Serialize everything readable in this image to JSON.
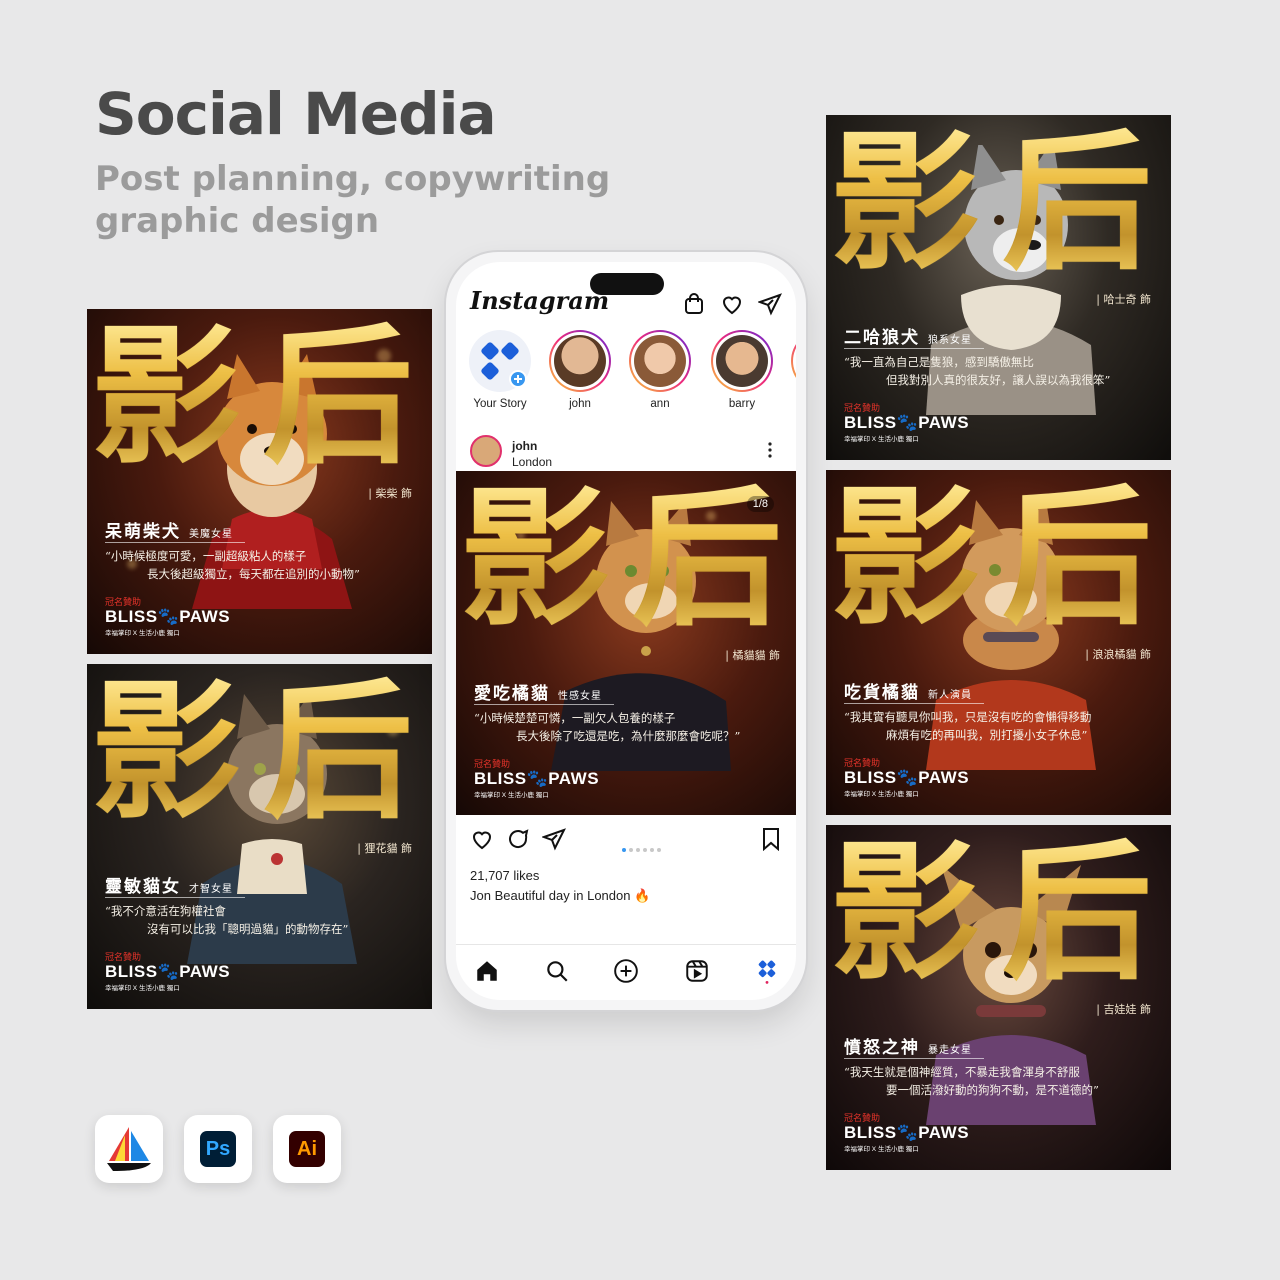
{
  "header": {
    "title": "Social Media",
    "subtitle": "Post planning, copywriting graphic design"
  },
  "poster_common": {
    "big_left": "影",
    "big_right": "后",
    "sponsor": "冠名贊助",
    "brand": "BLISS🐾PAWS",
    "brand_sub": "幸福掌印 X 生活小鹿 獨口"
  },
  "posters": [
    {
      "cast": "| 柴柴 飾",
      "role": "呆萌柴犬",
      "tag": "美魔女星",
      "quote": [
        "“小時候極度可愛，一副超級粘人的樣子",
        "長大後超級獨立，每天都在追別的小動物”"
      ],
      "animal": "shiba"
    },
    {
      "cast": "| 狸花貓 飾",
      "role": "靈敏貓女",
      "tag": "才智女星",
      "quote": [
        "“我不介意活在狗權社會",
        "沒有可以比我「聰明過貓」的動物存在”"
      ],
      "animal": "tabby"
    },
    {
      "cast": "| 哈士奇 飾",
      "role": "二哈狼犬",
      "tag": "狼系女星",
      "quote": [
        "“我一直為自己是隻狼，感到驕傲無比",
        "但我對別人真的很友好，讓人誤以為我很笨”"
      ],
      "animal": "husky"
    },
    {
      "cast": "| 浪浪橘貓 飾",
      "role": "吃貨橘貓",
      "tag": "新人演員",
      "quote": [
        "“我其實有聽見你叫我，只是沒有吃的會懶得移動",
        "麻煩有吃的再叫我，別打擾小女子休息”"
      ],
      "animal": "orange"
    },
    {
      "cast": "| 吉娃娃 飾",
      "role": "憤怒之神",
      "tag": "暴走女星",
      "quote": [
        "“我天生就是個神經質，不暴走我會渾身不舒服",
        "要一個活潑好動的狗狗不動，是不道德的”"
      ],
      "animal": "chihuahua"
    }
  ],
  "instagram": {
    "logo": "Instagram",
    "stories": [
      {
        "name": "Your Story"
      },
      {
        "name": "john"
      },
      {
        "name": "ann"
      },
      {
        "name": "barry"
      }
    ],
    "post": {
      "user": "john",
      "location": "London",
      "counter": "1/8",
      "cast": "| 橘貓貓 飾",
      "role": "愛吃橘貓",
      "tag": "性感女星",
      "quote": [
        "“小時候楚楚可憐，一副欠人包養的樣子",
        "長大後除了吃還是吃，為什麼那麼會吃呢？”"
      ],
      "likes": "21,707 likes",
      "caption_user": "Jon",
      "caption_text": "Beautiful day in London 🔥",
      "carousel_count": 6,
      "carousel_active": 1
    }
  },
  "tools": [
    {
      "name": "Midjourney",
      "label": "⛵",
      "bg": "#ffffff",
      "fg": "#111111"
    },
    {
      "name": "Photoshop",
      "label": "Ps",
      "bg": "#001e36",
      "fg": "#31a8ff"
    },
    {
      "name": "Illustrator",
      "label": "Ai",
      "bg": "#330000",
      "fg": "#ff9a00"
    }
  ]
}
